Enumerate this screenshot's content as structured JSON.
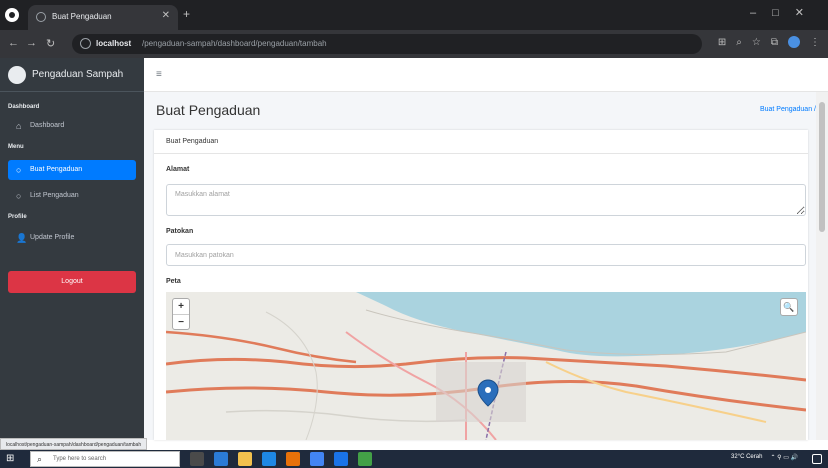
{
  "browser": {
    "tab_title": "Buat Pengaduan",
    "url_host": "localhost",
    "url_path": "/pengaduan-sampah/dashboard/pengaduan/tambah"
  },
  "sidebar": {
    "brand": "Pengaduan Sampah",
    "section_dashboard": "Dashboard",
    "item_dashboard": "Dashboard",
    "section_menu": "Menu",
    "item_buat": "Buat Pengaduan",
    "item_list": "List Pengaduan",
    "section_profile": "Profile",
    "item_update_profile": "Update Profile",
    "logout": "Logout"
  },
  "page": {
    "title": "Buat Pengaduan",
    "breadcrumb": "Buat Pengaduan /"
  },
  "form": {
    "card_title": "Buat Pengaduan",
    "alamat_label": "Alamat",
    "alamat_placeholder": "Masukkan alamat",
    "patokan_label": "Patokan",
    "patokan_placeholder": "Masukkan patokan",
    "peta_label": "Peta"
  },
  "map": {
    "zoom_in": "+",
    "zoom_out": "−",
    "search_icon": "🔍"
  },
  "status_url": "localhost/pengaduan-sampah/dashboard/pengaduan/tambah",
  "taskbar": {
    "search_placeholder": "Type here to search",
    "weather": "32°C Cerah"
  },
  "colors": {
    "sidebar_bg": "#343a40",
    "active_item": "#007bff",
    "logout": "#dc3545",
    "map_water": "#aad3df",
    "map_road": "#e07b5a",
    "marker": "#2a6ebb"
  }
}
